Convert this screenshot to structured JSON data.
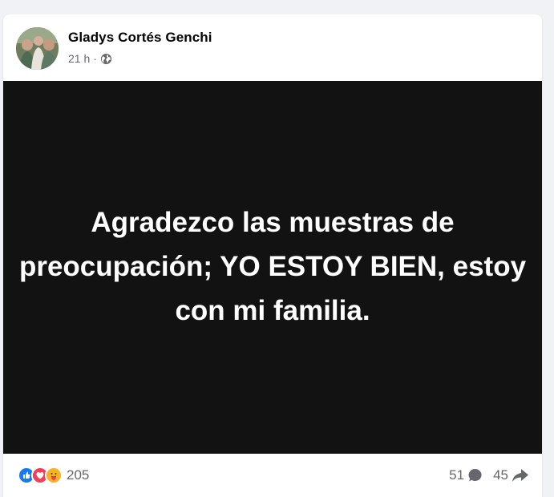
{
  "post": {
    "author": "Gladys Cortés Genchi",
    "time": "21 h",
    "separator": "·",
    "audience_icon": "globe-icon",
    "image_text": "Agradezco las muestras de preocupación; YO ESTOY BIEN, estoy con mi familia."
  },
  "engagement": {
    "reactions": [
      "like-icon",
      "love-icon",
      "care-icon"
    ],
    "reaction_count": "205",
    "comment_count": "51",
    "share_count": "45"
  },
  "colors": {
    "like": "#1877f2",
    "love": "#f33e58",
    "care": "#f7b125",
    "image_background": "#121212"
  }
}
